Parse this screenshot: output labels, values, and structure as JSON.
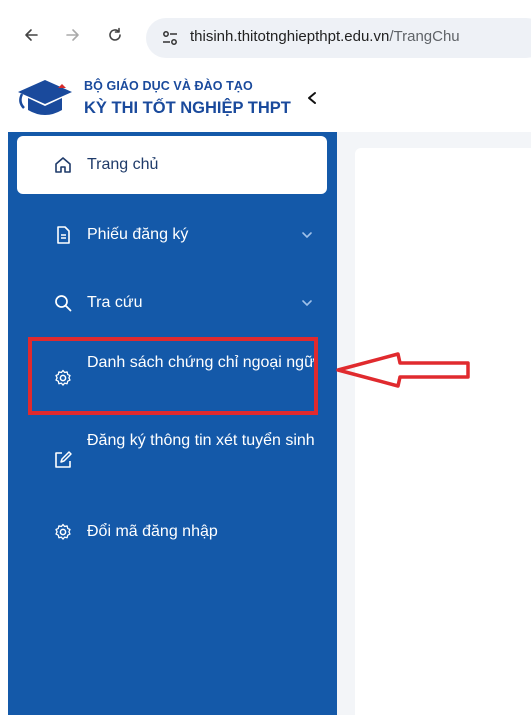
{
  "browser": {
    "url_host": "thisinh.thitotnghiepthpt.edu.vn",
    "url_path": "/TrangChu"
  },
  "header": {
    "org_name": "BỘ GIÁO DỤC VÀ ĐÀO TẠO",
    "exam_name": "KỲ THI TỐT NGHIỆP THPT"
  },
  "sidebar": {
    "items": [
      {
        "label": "Trang chủ",
        "icon": "home-icon"
      },
      {
        "label": "Phiếu đăng ký",
        "icon": "document-icon"
      },
      {
        "label": "Tra cứu",
        "icon": "search-icon"
      },
      {
        "label": "Danh sách chứng chỉ ngoại ngữ",
        "icon": "gear-icon"
      },
      {
        "label": "Đăng ký thông tin xét tuyển sinh",
        "icon": "edit-icon"
      },
      {
        "label": "Đổi mã đăng nhập",
        "icon": "gear-icon"
      }
    ]
  },
  "colors": {
    "sidebar_bg": "#1459a9",
    "brand_text": "#1a4a9c",
    "annotation": "#e02a2e"
  }
}
